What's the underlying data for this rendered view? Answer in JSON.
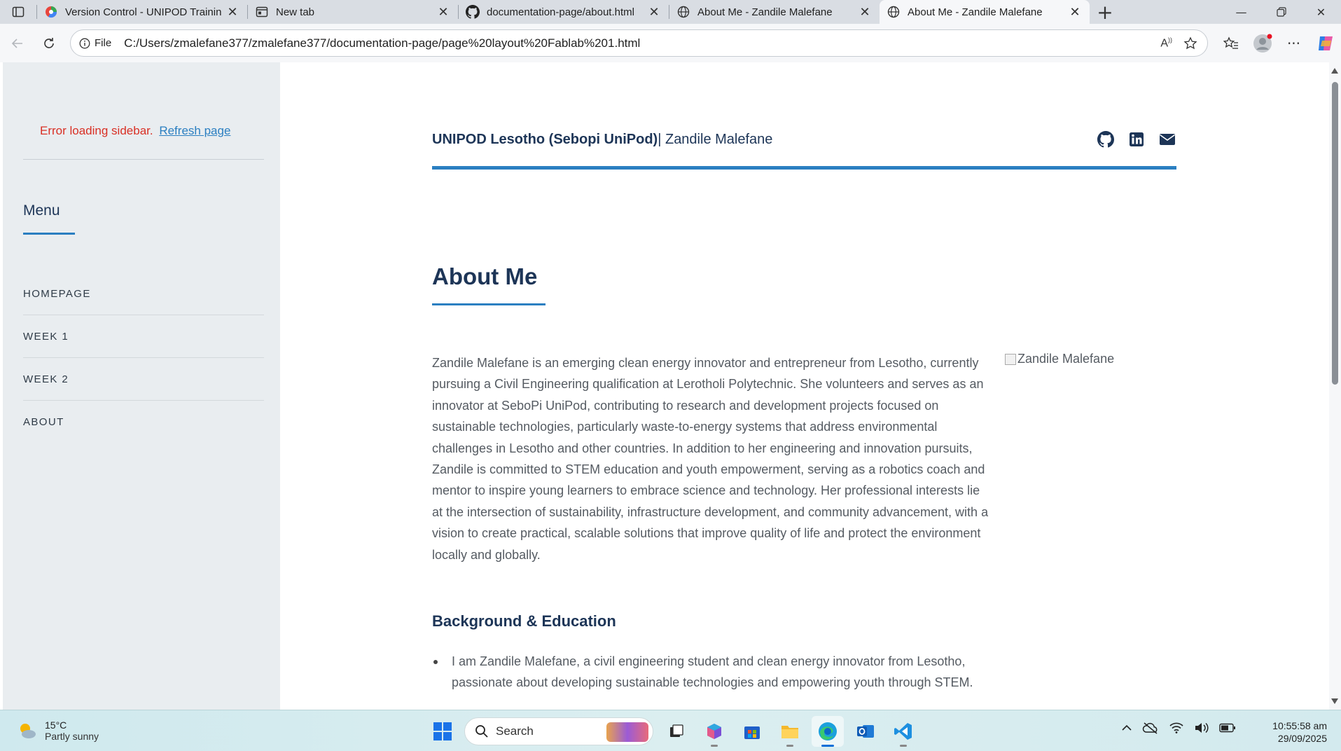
{
  "browser": {
    "tabs": [
      {
        "title": "Version Control - UNIPOD Trainin",
        "icon": "unipod-favicon",
        "active": false
      },
      {
        "title": "New tab",
        "icon": "newtab-icon",
        "active": false
      },
      {
        "title": "documentation-page/about.html",
        "icon": "github-icon",
        "active": false
      },
      {
        "title": "About Me - Zandile Malefane",
        "icon": "globe-icon",
        "active": false
      },
      {
        "title": "About Me - Zandile Malefane",
        "icon": "globe-icon",
        "active": true
      }
    ],
    "address": {
      "scheme_label": "File",
      "url": "C:/Users/zmalefane377/zmalefane377/documentation-page/page%20layout%20Fablab%201.html"
    }
  },
  "sidebar": {
    "error_text": "Error loading sidebar.",
    "refresh_link": "Refresh page",
    "menu_title": "Menu",
    "items": [
      {
        "label": "HOMEPAGE"
      },
      {
        "label": "WEEK 1"
      },
      {
        "label": "WEEK 2"
      },
      {
        "label": "ABOUT"
      }
    ]
  },
  "header": {
    "org": "UNIPOD Lesotho (Sebopi UniPod)",
    "name": "| Zandile Malefane",
    "social": [
      "github-icon",
      "linkedin-icon",
      "email-icon"
    ]
  },
  "main": {
    "heading": "About Me",
    "bio": "Zandile Malefane is an emerging clean energy innovator and entrepreneur from Lesotho, currently pursuing a Civil Engineering qualification at Lerotholi Polytechnic. She volunteers and serves as an innovator at SeboPi UniPod, contributing to research and development projects focused on sustainable technologies, particularly waste-to-energy systems that address environmental challenges in Lesotho and other countries. In addition to her engineering and innovation pursuits, Zandile is committed to STEM education and youth empowerment, serving as a robotics coach and mentor to inspire young learners to embrace science and technology. Her professional interests lie at the intersection of sustainability, infrastructure development, and community advancement, with a vision to create practical, scalable solutions that improve quality of life and protect the environment locally and globally.",
    "image_alt": "Zandile Malefane",
    "background_heading": "Background & Education",
    "background_items": [
      "I am Zandile Malefane, a civil engineering student and clean energy innovator from Lesotho, passionate about developing sustainable technologies and empowering youth through STEM."
    ]
  },
  "taskbar": {
    "weather_temp": "15°C",
    "weather_cond": "Partly sunny",
    "search_placeholder": "Search",
    "time": "10:55:58 am",
    "date": "29/09/2025"
  },
  "colors": {
    "accent": "#2b7fc1",
    "heading": "#1d3557",
    "error": "#d93025",
    "sidebar_bg": "#e9edf0"
  }
}
